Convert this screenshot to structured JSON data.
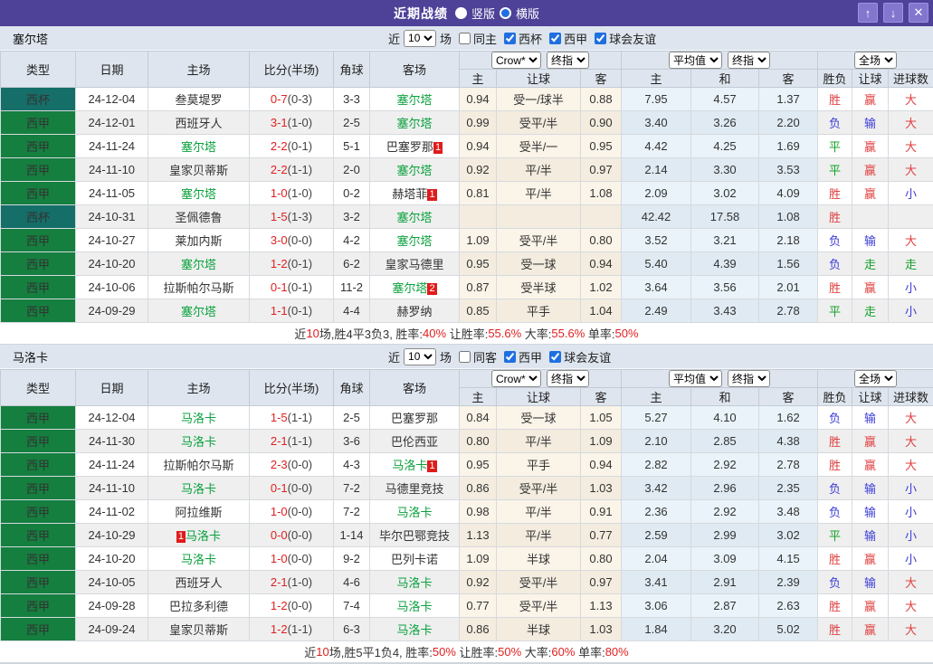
{
  "titlebar": {
    "title": "近期战绩",
    "radios": [
      {
        "label": "竖版",
        "checked": false
      },
      {
        "label": "横版",
        "checked": true
      }
    ],
    "buttons": {
      "up": "↑",
      "down": "↓",
      "close": "✕"
    }
  },
  "header": {
    "main_columns": [
      "类型",
      "日期",
      "主场",
      "比分(半场)",
      "角球",
      "客场"
    ],
    "sub_columns": [
      "主",
      "让球",
      "客",
      "主",
      "和",
      "客",
      "胜负",
      "让球",
      "进球数"
    ],
    "selects": {
      "odds_source": "Crow*",
      "odds_time1": "终指",
      "average": "平均值",
      "odds_time2": "终指",
      "scope": "全场"
    }
  },
  "colors": {
    "css_vars": {
      "titlebar-bg": "#4d4198",
      "accent-blue": "#1f6fe0",
      "header-bg": "#dee5ee",
      "stripe": "#efefef",
      "beige": "#fbf4e8",
      "beige-alt": "#f3ecdf",
      "ltblue": "#e9f3f9",
      "ltblue-alt": "#dfeaf2",
      "focus-team": "#0aa13e",
      "score-red": "#e02020",
      "res-red": "#e04040",
      "res-blue": "#3b3bd8",
      "res-green": "#15a02a",
      "card-red": "#e01b1b"
    },
    "type_colors": {
      "西甲": "#157f3f",
      "西杯": "#156e68"
    }
  },
  "result_color_map": {
    "胜": "r",
    "赢": "r",
    "大": "r",
    "负": "b",
    "输": "b",
    "小": "b",
    "平": "g",
    "走": "g"
  },
  "tables": [
    {
      "team": "塞尔塔",
      "filter": {
        "near_label": "近",
        "count": "10",
        "games_label": "场",
        "same": {
          "label": "同主",
          "checked": false
        },
        "leagues": [
          {
            "label": "西杯",
            "checked": true
          },
          {
            "label": "西甲",
            "checked": true
          },
          {
            "label": "球会友谊",
            "checked": true
          }
        ]
      },
      "rows": [
        {
          "lg": "西杯",
          "d": "24-12-04",
          "h": "叁莫堤罗",
          "hf": 0,
          "hcp": "",
          "s": "0-7",
          "sh": "(0-3)",
          "c": "3-3",
          "a": "塞尔塔",
          "af": 1,
          "ac": "",
          "o": [
            "0.94",
            "受一/球半",
            "0.88"
          ],
          "v": [
            "7.95",
            "4.57",
            "1.37"
          ],
          "r": [
            "胜",
            "赢",
            "大"
          ]
        },
        {
          "lg": "西甲",
          "d": "24-12-01",
          "h": "西班牙人",
          "hf": 0,
          "hcp": "",
          "s": "3-1",
          "sh": "(1-0)",
          "c": "2-5",
          "a": "塞尔塔",
          "af": 1,
          "ac": "",
          "o": [
            "0.99",
            "受平/半",
            "0.90"
          ],
          "v": [
            "3.40",
            "3.26",
            "2.20"
          ],
          "r": [
            "负",
            "输",
            "大"
          ]
        },
        {
          "lg": "西甲",
          "d": "24-11-24",
          "h": "塞尔塔",
          "hf": 1,
          "hcp": "",
          "s": "2-2",
          "sh": "(0-1)",
          "c": "5-1",
          "a": "巴塞罗那",
          "af": 0,
          "ac": "1",
          "o": [
            "0.94",
            "受半/一",
            "0.95"
          ],
          "v": [
            "4.42",
            "4.25",
            "1.69"
          ],
          "r": [
            "平",
            "赢",
            "大"
          ]
        },
        {
          "lg": "西甲",
          "d": "24-11-10",
          "h": "皇家贝蒂斯",
          "hf": 0,
          "hcp": "",
          "s": "2-2",
          "sh": "(1-1)",
          "c": "2-0",
          "a": "塞尔塔",
          "af": 1,
          "ac": "",
          "o": [
            "0.92",
            "平/半",
            "0.97"
          ],
          "v": [
            "2.14",
            "3.30",
            "3.53"
          ],
          "r": [
            "平",
            "赢",
            "大"
          ]
        },
        {
          "lg": "西甲",
          "d": "24-11-05",
          "h": "塞尔塔",
          "hf": 1,
          "hcp": "",
          "s": "1-0",
          "sh": "(1-0)",
          "c": "0-2",
          "a": "赫塔菲",
          "af": 0,
          "ac": "1",
          "o": [
            "0.81",
            "平/半",
            "1.08"
          ],
          "v": [
            "2.09",
            "3.02",
            "4.09"
          ],
          "r": [
            "胜",
            "赢",
            "小"
          ]
        },
        {
          "lg": "西杯",
          "d": "24-10-31",
          "h": "圣佩德鲁",
          "hf": 0,
          "hcp": "",
          "s": "1-5",
          "sh": "(1-3)",
          "c": "3-2",
          "a": "塞尔塔",
          "af": 1,
          "ac": "",
          "o": [
            "",
            "",
            ""
          ],
          "v": [
            "42.42",
            "17.58",
            "1.08"
          ],
          "r": [
            "胜",
            "",
            ""
          ]
        },
        {
          "lg": "西甲",
          "d": "24-10-27",
          "h": "莱加内斯",
          "hf": 0,
          "hcp": "",
          "s": "3-0",
          "sh": "(0-0)",
          "c": "4-2",
          "a": "塞尔塔",
          "af": 1,
          "ac": "",
          "o": [
            "1.09",
            "受平/半",
            "0.80"
          ],
          "v": [
            "3.52",
            "3.21",
            "2.18"
          ],
          "r": [
            "负",
            "输",
            "大"
          ]
        },
        {
          "lg": "西甲",
          "d": "24-10-20",
          "h": "塞尔塔",
          "hf": 1,
          "hcp": "",
          "s": "1-2",
          "sh": "(0-1)",
          "c": "6-2",
          "a": "皇家马德里",
          "af": 0,
          "ac": "",
          "o": [
            "0.95",
            "受一球",
            "0.94"
          ],
          "v": [
            "5.40",
            "4.39",
            "1.56"
          ],
          "r": [
            "负",
            "走",
            "走"
          ]
        },
        {
          "lg": "西甲",
          "d": "24-10-06",
          "h": "拉斯帕尔马斯",
          "hf": 0,
          "hcp": "",
          "s": "0-1",
          "sh": "(0-1)",
          "c": "11-2",
          "a": "塞尔塔",
          "af": 1,
          "ac": "2",
          "o": [
            "0.87",
            "受半球",
            "1.02"
          ],
          "v": [
            "3.64",
            "3.56",
            "2.01"
          ],
          "r": [
            "胜",
            "赢",
            "小"
          ]
        },
        {
          "lg": "西甲",
          "d": "24-09-29",
          "h": "塞尔塔",
          "hf": 1,
          "hcp": "",
          "s": "1-1",
          "sh": "(0-1)",
          "c": "4-4",
          "a": "赫罗纳",
          "af": 0,
          "ac": "",
          "o": [
            "0.85",
            "平手",
            "1.04"
          ],
          "v": [
            "2.49",
            "3.43",
            "2.78"
          ],
          "r": [
            "平",
            "走",
            "小"
          ]
        }
      ],
      "summary": [
        [
          "近",
          "k"
        ],
        [
          "10",
          "r"
        ],
        [
          "场,胜4平3负3, 胜率:",
          "k"
        ],
        [
          "40%",
          "r"
        ],
        [
          " 让胜率:",
          "k"
        ],
        [
          "55.6%",
          "r"
        ],
        [
          " 大率:",
          "k"
        ],
        [
          "55.6%",
          "r"
        ],
        [
          " 单率:",
          "k"
        ],
        [
          "50%",
          "r"
        ]
      ]
    },
    {
      "team": "马洛卡",
      "filter": {
        "near_label": "近",
        "count": "10",
        "games_label": "场",
        "same": {
          "label": "同客",
          "checked": false
        },
        "leagues": [
          {
            "label": "西甲",
            "checked": true
          },
          {
            "label": "球会友谊",
            "checked": true
          }
        ]
      },
      "rows": [
        {
          "lg": "西甲",
          "d": "24-12-04",
          "h": "马洛卡",
          "hf": 1,
          "hcp": "",
          "s": "1-5",
          "sh": "(1-1)",
          "c": "2-5",
          "a": "巴塞罗那",
          "af": 0,
          "ac": "",
          "o": [
            "0.84",
            "受一球",
            "1.05"
          ],
          "v": [
            "5.27",
            "4.10",
            "1.62"
          ],
          "r": [
            "负",
            "输",
            "大"
          ]
        },
        {
          "lg": "西甲",
          "d": "24-11-30",
          "h": "马洛卡",
          "hf": 1,
          "hcp": "",
          "s": "2-1",
          "sh": "(1-1)",
          "c": "3-6",
          "a": "巴伦西亚",
          "af": 0,
          "ac": "",
          "o": [
            "0.80",
            "平/半",
            "1.09"
          ],
          "v": [
            "2.10",
            "2.85",
            "4.38"
          ],
          "r": [
            "胜",
            "赢",
            "大"
          ]
        },
        {
          "lg": "西甲",
          "d": "24-11-24",
          "h": "拉斯帕尔马斯",
          "hf": 0,
          "hcp": "",
          "s": "2-3",
          "sh": "(0-0)",
          "c": "4-3",
          "a": "马洛卡",
          "af": 1,
          "ac": "1",
          "o": [
            "0.95",
            "平手",
            "0.94"
          ],
          "v": [
            "2.82",
            "2.92",
            "2.78"
          ],
          "r": [
            "胜",
            "赢",
            "大"
          ]
        },
        {
          "lg": "西甲",
          "d": "24-11-10",
          "h": "马洛卡",
          "hf": 1,
          "hcp": "",
          "s": "0-1",
          "sh": "(0-0)",
          "c": "7-2",
          "a": "马德里竞技",
          "af": 0,
          "ac": "",
          "o": [
            "0.86",
            "受平/半",
            "1.03"
          ],
          "v": [
            "3.42",
            "2.96",
            "2.35"
          ],
          "r": [
            "负",
            "输",
            "小"
          ]
        },
        {
          "lg": "西甲",
          "d": "24-11-02",
          "h": "阿拉维斯",
          "hf": 0,
          "hcp": "",
          "s": "1-0",
          "sh": "(0-0)",
          "c": "7-2",
          "a": "马洛卡",
          "af": 1,
          "ac": "",
          "o": [
            "0.98",
            "平/半",
            "0.91"
          ],
          "v": [
            "2.36",
            "2.92",
            "3.48"
          ],
          "r": [
            "负",
            "输",
            "小"
          ]
        },
        {
          "lg": "西甲",
          "d": "24-10-29",
          "h": "马洛卡",
          "hf": 1,
          "hcp": "1",
          "s": "0-0",
          "sh": "(0-0)",
          "c": "1-14",
          "a": "毕尔巴鄂竞技",
          "af": 0,
          "ac": "",
          "o": [
            "1.13",
            "平/半",
            "0.77"
          ],
          "v": [
            "2.59",
            "2.99",
            "3.02"
          ],
          "r": [
            "平",
            "输",
            "小"
          ]
        },
        {
          "lg": "西甲",
          "d": "24-10-20",
          "h": "马洛卡",
          "hf": 1,
          "hcp": "",
          "s": "1-0",
          "sh": "(0-0)",
          "c": "9-2",
          "a": "巴列卡诺",
          "af": 0,
          "ac": "",
          "o": [
            "1.09",
            "半球",
            "0.80"
          ],
          "v": [
            "2.04",
            "3.09",
            "4.15"
          ],
          "r": [
            "胜",
            "赢",
            "小"
          ]
        },
        {
          "lg": "西甲",
          "d": "24-10-05",
          "h": "西班牙人",
          "hf": 0,
          "hcp": "",
          "s": "2-1",
          "sh": "(1-0)",
          "c": "4-6",
          "a": "马洛卡",
          "af": 1,
          "ac": "",
          "o": [
            "0.92",
            "受平/半",
            "0.97"
          ],
          "v": [
            "3.41",
            "2.91",
            "2.39"
          ],
          "r": [
            "负",
            "输",
            "大"
          ]
        },
        {
          "lg": "西甲",
          "d": "24-09-28",
          "h": "巴拉多利德",
          "hf": 0,
          "hcp": "",
          "s": "1-2",
          "sh": "(0-0)",
          "c": "7-4",
          "a": "马洛卡",
          "af": 1,
          "ac": "",
          "o": [
            "0.77",
            "受平/半",
            "1.13"
          ],
          "v": [
            "3.06",
            "2.87",
            "2.63"
          ],
          "r": [
            "胜",
            "赢",
            "大"
          ]
        },
        {
          "lg": "西甲",
          "d": "24-09-24",
          "h": "皇家贝蒂斯",
          "hf": 0,
          "hcp": "",
          "s": "1-2",
          "sh": "(1-1)",
          "c": "6-3",
          "a": "马洛卡",
          "af": 1,
          "ac": "",
          "o": [
            "0.86",
            "半球",
            "1.03"
          ],
          "v": [
            "1.84",
            "3.20",
            "5.02"
          ],
          "r": [
            "胜",
            "赢",
            "大"
          ]
        }
      ],
      "summary": [
        [
          "近",
          "k"
        ],
        [
          "10",
          "r"
        ],
        [
          "场,胜5平1负4, 胜率:",
          "k"
        ],
        [
          "50%",
          "r"
        ],
        [
          " 让胜率:",
          "k"
        ],
        [
          "50%",
          "r"
        ],
        [
          " 大率:",
          "k"
        ],
        [
          "60%",
          "r"
        ],
        [
          " 单率:",
          "k"
        ],
        [
          "80%",
          "r"
        ]
      ]
    }
  ]
}
